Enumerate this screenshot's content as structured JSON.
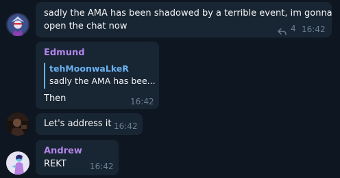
{
  "messages": [
    {
      "lines": [
        "sadly the AMA has been shadowed by a terrible event, im gonna",
        "open the chat now"
      ],
      "forward_count": "4",
      "time": "16:42"
    },
    {
      "sender": "Edmund",
      "reply_author": "tehMoonwaLkeR",
      "reply_text": "sadly the AMA has bee...",
      "text": "Then",
      "time": "16:42"
    },
    {
      "text": "Let's address it",
      "time": "16:42"
    },
    {
      "sender": "Andrew",
      "text": "REKT",
      "time": "16:42"
    }
  ],
  "icons": [
    "forward-icon"
  ],
  "colors": {
    "background": "#0e1621",
    "bubble": "#182533",
    "sender_name": "#b184e8",
    "reply_accent": "#6ab2f2",
    "meta": "#6d7f8f"
  }
}
